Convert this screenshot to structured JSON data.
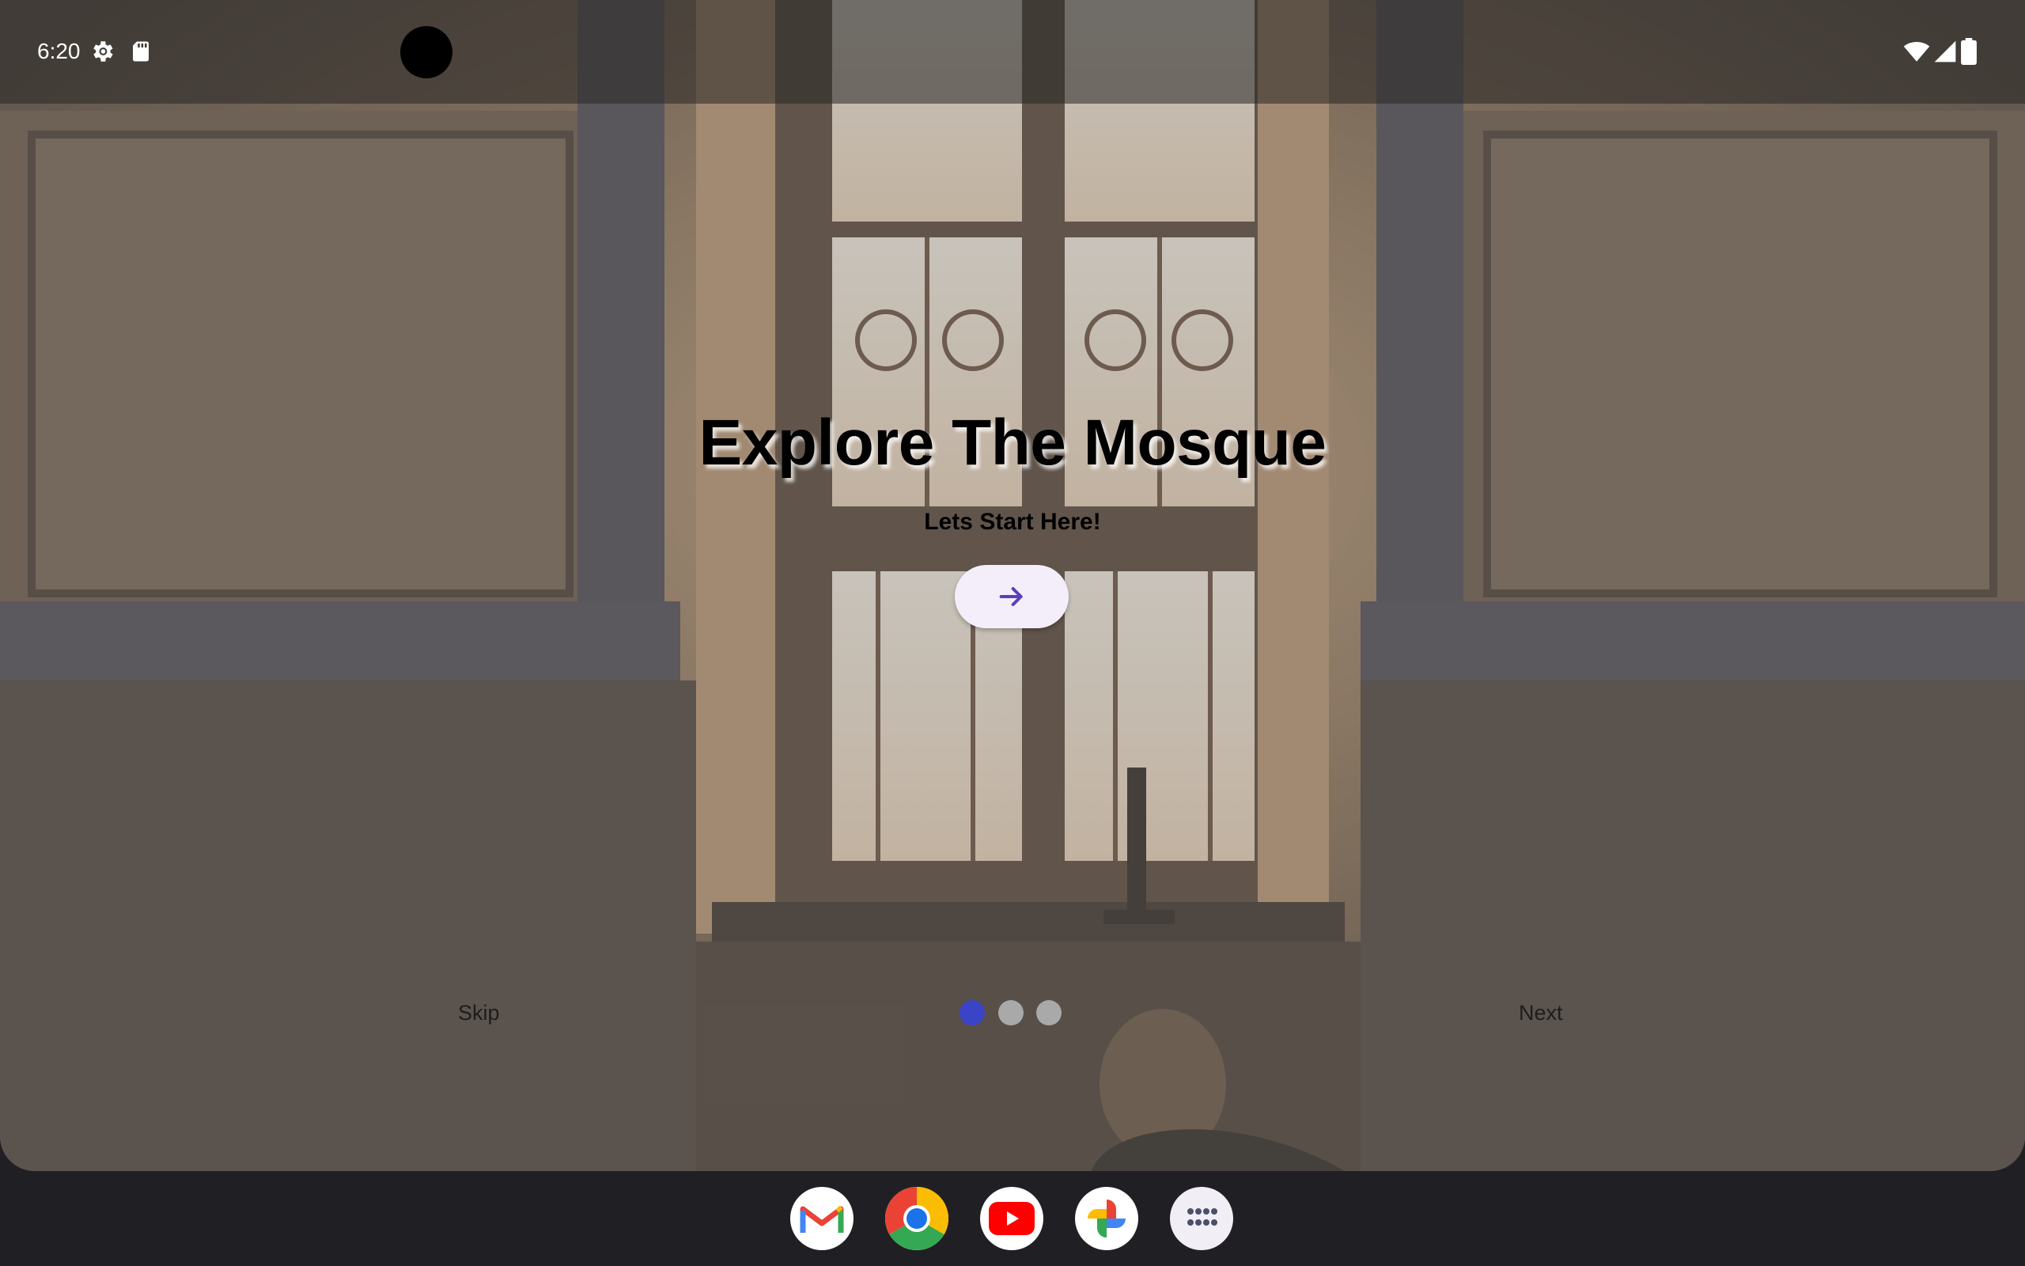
{
  "status_bar": {
    "time": "6:20",
    "icons": [
      "settings-gear-icon",
      "sd-card-icon",
      "wifi-icon",
      "cellular-signal-icon",
      "battery-icon"
    ]
  },
  "onboarding": {
    "title": "Explore The Mosque",
    "subtitle": "Lets Start Here!",
    "start_button_icon": "arrow-right-icon",
    "skip_label": "Skip",
    "next_label": "Next",
    "page_indicator": {
      "total": 3,
      "current": 1
    }
  },
  "dock": {
    "apps": [
      "Gmail",
      "Chrome",
      "YouTube",
      "Photos",
      "App drawer"
    ]
  },
  "colors": {
    "accent": "#5b3fb8",
    "dot_active": "#3b44c6",
    "dot_inactive": "#a9a9a9",
    "button_bg": "#f4eefa"
  }
}
